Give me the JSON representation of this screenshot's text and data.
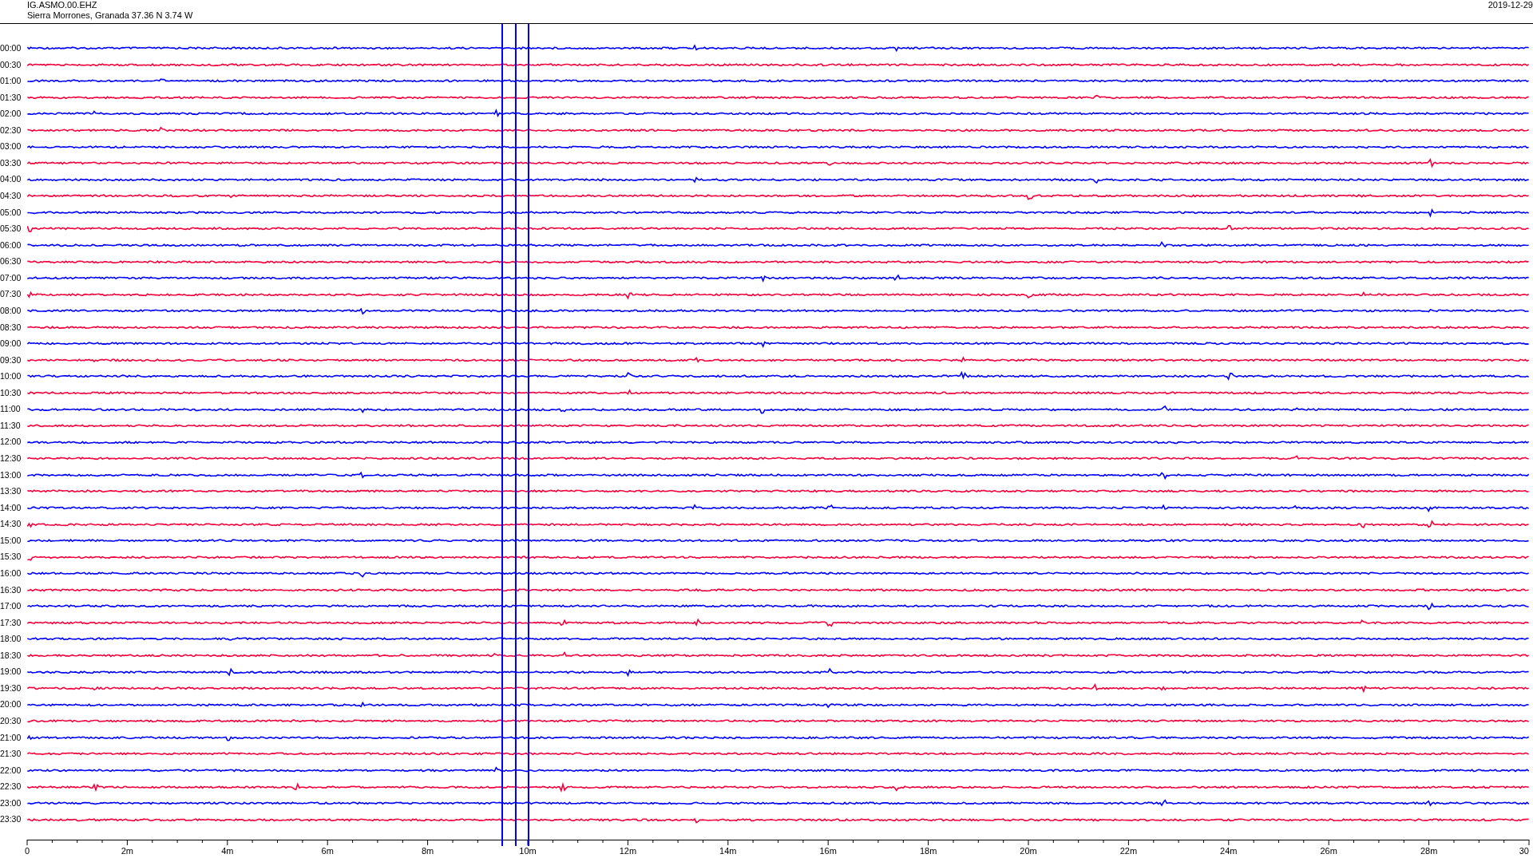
{
  "header": {
    "station": "IG.ASMO.00.EHZ",
    "location": "Sierra Morrones, Granada  37.36 N 3.74 W",
    "date": "2019-12-29"
  },
  "rows": [
    {
      "label": "00:00",
      "color": "#0000ff"
    },
    {
      "label": "00:30",
      "color": "#f5003c"
    },
    {
      "label": "01:00",
      "color": "#0000ff"
    },
    {
      "label": "01:30",
      "color": "#f5003c"
    },
    {
      "label": "02:00",
      "color": "#0000ff"
    },
    {
      "label": "02:30",
      "color": "#f5003c"
    },
    {
      "label": "03:00",
      "color": "#0000ff"
    },
    {
      "label": "03:30",
      "color": "#f5003c"
    },
    {
      "label": "04:00",
      "color": "#0000ff"
    },
    {
      "label": "04:30",
      "color": "#f5003c"
    },
    {
      "label": "05:00",
      "color": "#0000ff"
    },
    {
      "label": "05:30",
      "color": "#f5003c"
    },
    {
      "label": "06:00",
      "color": "#0000ff"
    },
    {
      "label": "06:30",
      "color": "#f5003c"
    },
    {
      "label": "07:00",
      "color": "#0000ff"
    },
    {
      "label": "07:30",
      "color": "#f5003c"
    },
    {
      "label": "08:00",
      "color": "#0000ff"
    },
    {
      "label": "08:30",
      "color": "#f5003c"
    },
    {
      "label": "09:00",
      "color": "#0000ff"
    },
    {
      "label": "09:30",
      "color": "#f5003c"
    },
    {
      "label": "10:00",
      "color": "#0000ff"
    },
    {
      "label": "10:30",
      "color": "#f5003c"
    },
    {
      "label": "11:00",
      "color": "#0000ff"
    },
    {
      "label": "11:30",
      "color": "#f5003c"
    },
    {
      "label": "12:00",
      "color": "#0000ff"
    },
    {
      "label": "12:30",
      "color": "#f5003c"
    },
    {
      "label": "13:00",
      "color": "#0000ff"
    },
    {
      "label": "13:30",
      "color": "#f5003c"
    },
    {
      "label": "14:00",
      "color": "#0000ff"
    },
    {
      "label": "14:30",
      "color": "#f5003c"
    },
    {
      "label": "15:00",
      "color": "#0000ff"
    },
    {
      "label": "15:30",
      "color": "#f5003c"
    },
    {
      "label": "16:00",
      "color": "#0000ff"
    },
    {
      "label": "16:30",
      "color": "#f5003c"
    },
    {
      "label": "17:00",
      "color": "#0000ff"
    },
    {
      "label": "17:30",
      "color": "#f5003c"
    },
    {
      "label": "18:00",
      "color": "#0000ff"
    },
    {
      "label": "18:30",
      "color": "#f5003c"
    },
    {
      "label": "19:00",
      "color": "#0000ff"
    },
    {
      "label": "19:30",
      "color": "#f5003c"
    },
    {
      "label": "20:00",
      "color": "#0000ff"
    },
    {
      "label": "20:30",
      "color": "#f5003c"
    },
    {
      "label": "21:00",
      "color": "#0000ff"
    },
    {
      "label": "21:30",
      "color": "#f5003c"
    },
    {
      "label": "22:00",
      "color": "#0000ff"
    },
    {
      "label": "22:30",
      "color": "#f5003c"
    },
    {
      "label": "23:00",
      "color": "#0000ff"
    },
    {
      "label": "23:30",
      "color": "#f5003c"
    }
  ],
  "x_axis": {
    "labels": [
      "0",
      "2m",
      "4m",
      "6m",
      "8m",
      "10m",
      "12m",
      "14m",
      "16m",
      "18m",
      "20m",
      "22m",
      "24m",
      "26m",
      "28m",
      "30"
    ]
  }
}
